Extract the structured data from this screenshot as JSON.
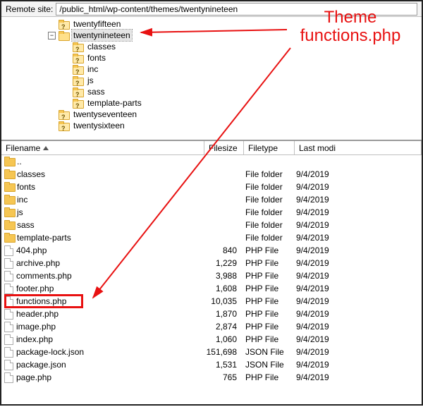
{
  "topbar": {
    "label": "Remote site:",
    "path": "/public_html/wp-content/themes/twentynineteen"
  },
  "tree": {
    "rootIndent": 58,
    "childIndent": 20,
    "items": [
      {
        "depth": 0,
        "toggle": "",
        "icon": "q",
        "label": "twentyfifteen"
      },
      {
        "depth": 0,
        "toggle": "−",
        "icon": "open",
        "label": "twentynineteen",
        "selected": true
      },
      {
        "depth": 1,
        "toggle": "",
        "icon": "q",
        "label": "classes"
      },
      {
        "depth": 1,
        "toggle": "",
        "icon": "q",
        "label": "fonts"
      },
      {
        "depth": 1,
        "toggle": "",
        "icon": "q",
        "label": "inc"
      },
      {
        "depth": 1,
        "toggle": "",
        "icon": "q",
        "label": "js"
      },
      {
        "depth": 1,
        "toggle": "",
        "icon": "q",
        "label": "sass"
      },
      {
        "depth": 1,
        "toggle": "",
        "icon": "q",
        "label": "template-parts"
      },
      {
        "depth": 0,
        "toggle": "",
        "icon": "q",
        "label": "twentyseventeen"
      },
      {
        "depth": 0,
        "toggle": "",
        "icon": "q",
        "label": "twentysixteen"
      }
    ]
  },
  "list": {
    "columns": {
      "name": "Filename",
      "size": "Filesize",
      "type": "Filetype",
      "modified": "Last modi"
    },
    "rows": [
      {
        "kind": "up",
        "name": "..",
        "size": "",
        "type": "",
        "modified": ""
      },
      {
        "kind": "dir",
        "name": "classes",
        "size": "",
        "type": "File folder",
        "modified": "9/4/2019"
      },
      {
        "kind": "dir",
        "name": "fonts",
        "size": "",
        "type": "File folder",
        "modified": "9/4/2019"
      },
      {
        "kind": "dir",
        "name": "inc",
        "size": "",
        "type": "File folder",
        "modified": "9/4/2019"
      },
      {
        "kind": "dir",
        "name": "js",
        "size": "",
        "type": "File folder",
        "modified": "9/4/2019"
      },
      {
        "kind": "dir",
        "name": "sass",
        "size": "",
        "type": "File folder",
        "modified": "9/4/2019"
      },
      {
        "kind": "dir",
        "name": "template-parts",
        "size": "",
        "type": "File folder",
        "modified": "9/4/2019"
      },
      {
        "kind": "file",
        "name": "404.php",
        "size": "840",
        "type": "PHP File",
        "modified": "9/4/2019"
      },
      {
        "kind": "file",
        "name": "archive.php",
        "size": "1,229",
        "type": "PHP File",
        "modified": "9/4/2019"
      },
      {
        "kind": "file",
        "name": "comments.php",
        "size": "3,988",
        "type": "PHP File",
        "modified": "9/4/2019"
      },
      {
        "kind": "file",
        "name": "footer.php",
        "size": "1,608",
        "type": "PHP File",
        "modified": "9/4/2019"
      },
      {
        "kind": "file",
        "name": "functions.php",
        "size": "10,035",
        "type": "PHP File",
        "modified": "9/4/2019",
        "highlight": true
      },
      {
        "kind": "file",
        "name": "header.php",
        "size": "1,870",
        "type": "PHP File",
        "modified": "9/4/2019"
      },
      {
        "kind": "file",
        "name": "image.php",
        "size": "2,874",
        "type": "PHP File",
        "modified": "9/4/2019"
      },
      {
        "kind": "file",
        "name": "index.php",
        "size": "1,060",
        "type": "PHP File",
        "modified": "9/4/2019"
      },
      {
        "kind": "file",
        "name": "package-lock.json",
        "size": "151,698",
        "type": "JSON File",
        "modified": "9/4/2019"
      },
      {
        "kind": "file",
        "name": "package.json",
        "size": "1,531",
        "type": "JSON File",
        "modified": "9/4/2019"
      },
      {
        "kind": "file",
        "name": "page.php",
        "size": "765",
        "type": "PHP File",
        "modified": "9/4/2019"
      }
    ]
  },
  "annotation": {
    "line1": "Theme",
    "line2": "functions.php"
  }
}
